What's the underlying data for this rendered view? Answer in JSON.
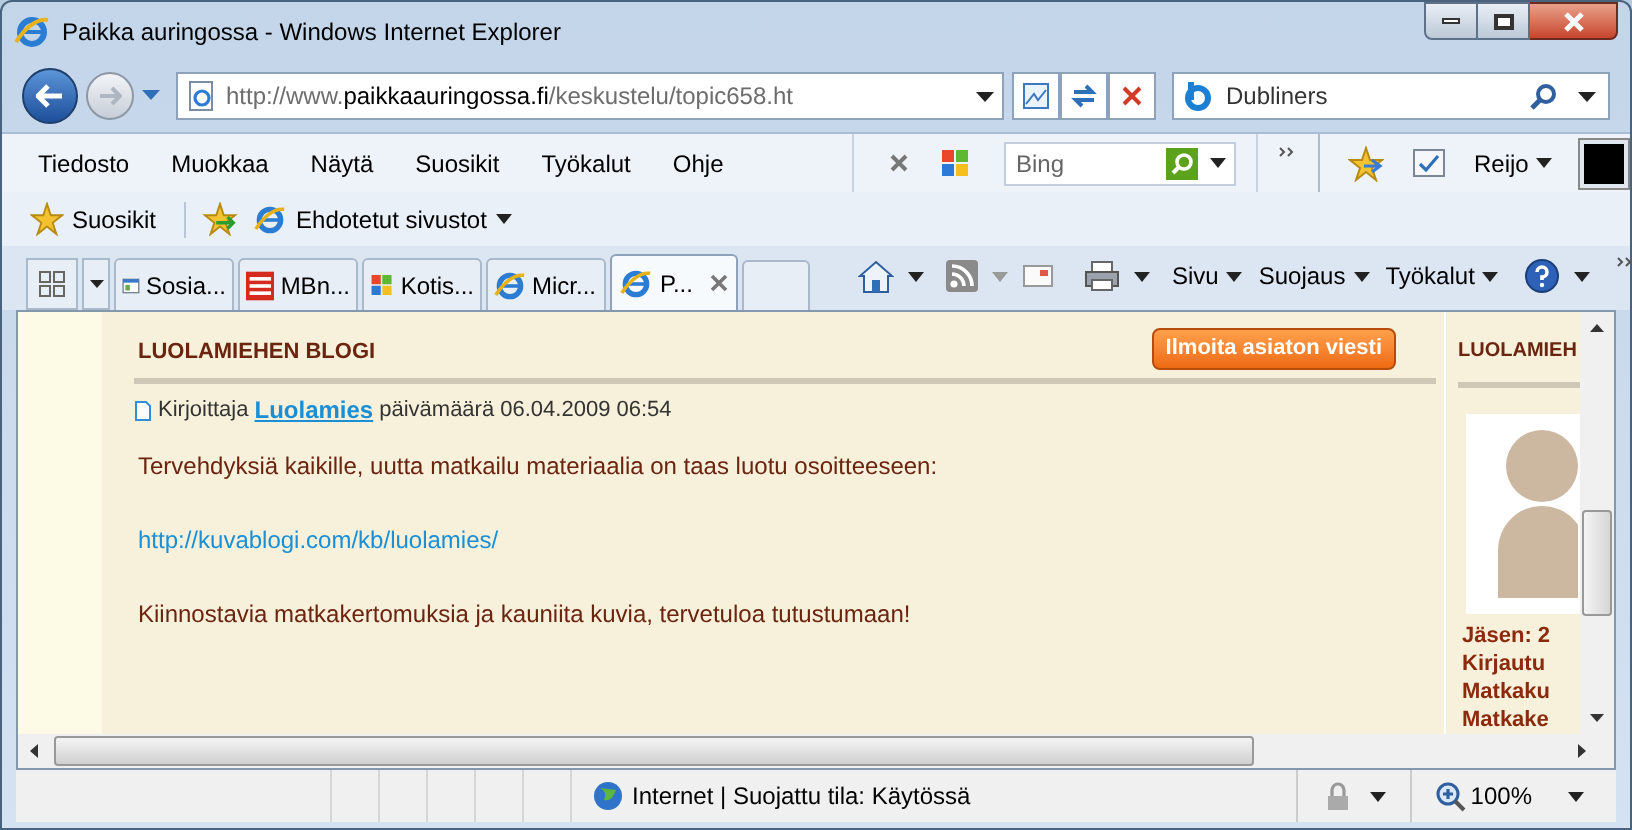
{
  "window": {
    "title": "Paikka auringossa - Windows Internet Explorer"
  },
  "address_bar": {
    "scheme": "http://www.",
    "domain": "paikkaauringossa.fi",
    "path": "/keskustelu/topic658.ht"
  },
  "search_box": {
    "value": "Dubliners"
  },
  "menu": [
    "Tiedosto",
    "Muokkaa",
    "Näytä",
    "Suosikit",
    "Työkalut",
    "Ohje"
  ],
  "bing_search": {
    "placeholder": "Bing"
  },
  "user_menu": "Reijo",
  "favorites_bar": {
    "favorites": "Suosikit",
    "suggested_sites": "Ehdotetut sivustot"
  },
  "tabs": [
    {
      "label": "Sosia...",
      "selected": false,
      "kind": "window"
    },
    {
      "label": "MBn...",
      "selected": false,
      "kind": "mb"
    },
    {
      "label": "Kotis...",
      "selected": false,
      "kind": "flag"
    },
    {
      "label": "Micr...",
      "selected": false,
      "kind": "ie"
    },
    {
      "label": "P...",
      "selected": true,
      "kind": "ie"
    }
  ],
  "command_bar": [
    "Sivu",
    "Suojaus",
    "Työkalut"
  ],
  "page": {
    "blog_title": "LUOLAMIEHEN BLOGI",
    "report_button": "Ilmoita asiaton viesti",
    "byline": {
      "prefix": "Kirjoittaja",
      "author": "Luolamies",
      "date": "päivämäärä 06.04.2009 06:54"
    },
    "paragraphs": [
      {
        "kind": "text",
        "text": "Tervehdyksiä kaikille, uutta matkailu materiaalia on taas luotu osoitteeseen:"
      },
      {
        "kind": "link",
        "text": "http://kuvablogi.com/kb/luolamies/"
      },
      {
        "kind": "text",
        "text": "Kiinnostavia matkakertomuksia ja kauniita kuvia, tervetuloa tutustumaan!"
      }
    ],
    "sidebar": {
      "heading": "LUOLAMIEH",
      "stats": [
        "Jäsen: 2",
        "Kirjautu",
        "Matkaku",
        "Matkake"
      ]
    }
  },
  "status_bar": {
    "zone": "Internet | Suojattu tila: Käytössä",
    "zoom": "100%"
  }
}
